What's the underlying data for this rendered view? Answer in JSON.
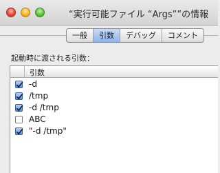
{
  "window": {
    "title": "“実行可能ファイル “Args””の情報"
  },
  "tabs": [
    {
      "label": "一般",
      "selected": false
    },
    {
      "label": "引数",
      "selected": true
    },
    {
      "label": "デバッグ",
      "selected": false
    },
    {
      "label": "コメント",
      "selected": false
    }
  ],
  "arguments_panel": {
    "label": "起動時に渡される引数：",
    "column_header": "引数",
    "rows": [
      {
        "value": "-d",
        "checked": true
      },
      {
        "value": "/tmp",
        "checked": true
      },
      {
        "value": "-d /tmp",
        "checked": true
      },
      {
        "value": "ABC",
        "checked": false
      },
      {
        "value": "\"-d /tmp\"",
        "checked": true
      }
    ]
  },
  "colors": {
    "accent": "#5c8ddb",
    "selected_tab": "#a9c6ef",
    "window_background": "#ececec"
  }
}
